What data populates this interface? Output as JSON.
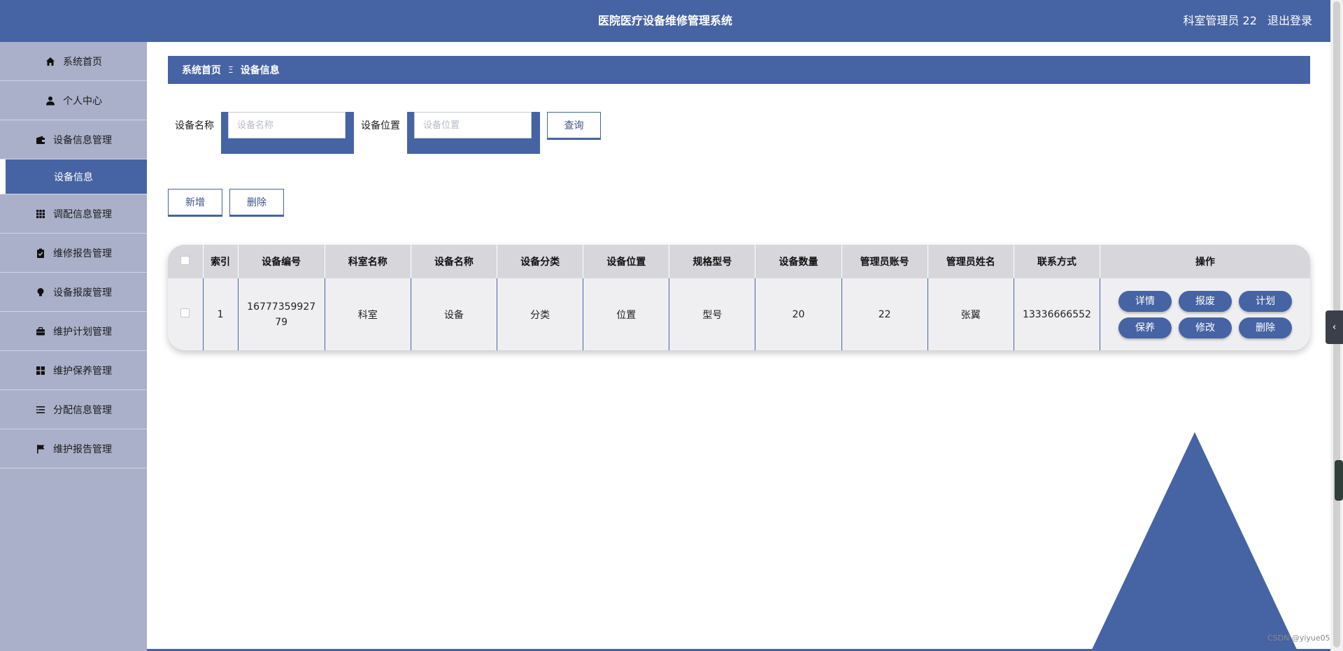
{
  "header": {
    "title": "医院医疗设备维修管理系统",
    "user": "科室管理员 22",
    "logout": "退出登录"
  },
  "sidebar": {
    "items": [
      {
        "label": "系统首页",
        "icon": "home-icon"
      },
      {
        "label": "个人中心",
        "icon": "user-icon"
      },
      {
        "label": "设备信息管理",
        "icon": "wallet-icon"
      },
      {
        "label": "设备信息",
        "icon": "",
        "active": true
      },
      {
        "label": "调配信息管理",
        "icon": "grid-icon"
      },
      {
        "label": "维修报告管理",
        "icon": "clipboard-check-icon"
      },
      {
        "label": "设备报废管理",
        "icon": "bulb-icon"
      },
      {
        "label": "维护计划管理",
        "icon": "briefcase-icon"
      },
      {
        "label": "维护保养管理",
        "icon": "apps-icon"
      },
      {
        "label": "分配信息管理",
        "icon": "list-icon"
      },
      {
        "label": "维护报告管理",
        "icon": "flag-icon"
      }
    ]
  },
  "breadcrumb": {
    "home": "系统首页",
    "separator": "Ξ",
    "current": "设备信息"
  },
  "search": {
    "name_label": "设备名称",
    "name_placeholder": "设备名称",
    "name_value": "",
    "location_label": "设备位置",
    "location_placeholder": "设备位置",
    "location_value": "",
    "query_button": "查询"
  },
  "actions": {
    "add": "新增",
    "delete": "删除"
  },
  "table": {
    "columns": [
      "索引",
      "设备编号",
      "科室名称",
      "设备名称",
      "设备分类",
      "设备位置",
      "规格型号",
      "设备数量",
      "管理员账号",
      "管理员姓名",
      "联系方式",
      "操作"
    ],
    "rows": [
      {
        "index": "1",
        "device_no": "1677735992779",
        "dept": "科室",
        "device_name": "设备",
        "category": "分类",
        "location": "位置",
        "model": "型号",
        "quantity": "20",
        "admin_account": "22",
        "admin_name": "张翼",
        "contact": "13336666552",
        "ops": [
          "详情",
          "报废",
          "计划",
          "保养",
          "修改",
          "删除"
        ]
      }
    ]
  },
  "watermark": "CSDN @yiyue05",
  "colors": {
    "primary": "#4663a3",
    "sidebar": "#aab0ca",
    "header_row": "#d7d7db",
    "body_row": "#efeff2"
  }
}
